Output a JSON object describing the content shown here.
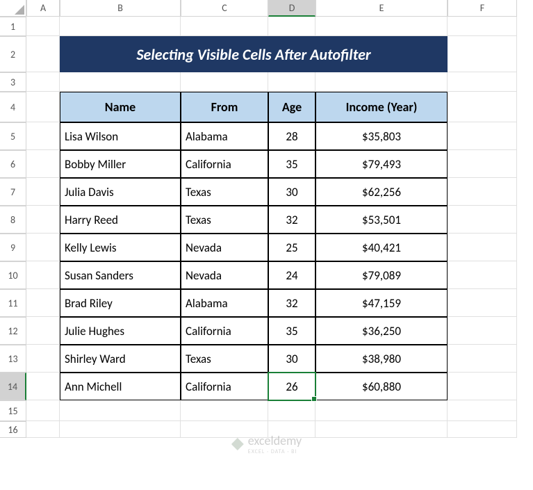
{
  "columns": [
    "A",
    "B",
    "C",
    "D",
    "E",
    "F"
  ],
  "rows": [
    "1",
    "2",
    "3",
    "4",
    "5",
    "6",
    "7",
    "8",
    "9",
    "10",
    "11",
    "12",
    "13",
    "14",
    "15",
    "16"
  ],
  "selected_column": "D",
  "selected_row": "14",
  "title": "Selecting Visible Cells After Autofilter",
  "headers": {
    "name": "Name",
    "from": "From",
    "age": "Age",
    "income": "Income (Year)"
  },
  "data": [
    {
      "name": "Lisa Wilson",
      "from": "Alabama",
      "age": "28",
      "income": "$35,803"
    },
    {
      "name": "Bobby Miller",
      "from": "California",
      "age": "35",
      "income": "$79,493"
    },
    {
      "name": "Julia Davis",
      "from": "Texas",
      "age": "30",
      "income": "$62,256"
    },
    {
      "name": "Harry Reed",
      "from": "Texas",
      "age": "32",
      "income": "$53,501"
    },
    {
      "name": "Kelly Lewis",
      "from": "Nevada",
      "age": "25",
      "income": "$40,421"
    },
    {
      "name": "Susan Sanders",
      "from": "Nevada",
      "age": "24",
      "income": "$79,089"
    },
    {
      "name": "Brad Riley",
      "from": "Alabama",
      "age": "32",
      "income": "$47,159"
    },
    {
      "name": "Julie Hughes",
      "from": "California",
      "age": "35",
      "income": "$36,250"
    },
    {
      "name": "Shirley Ward",
      "from": "Texas",
      "age": "30",
      "income": "$38,980"
    },
    {
      "name": "Ann Michell",
      "from": "California",
      "age": "26",
      "income": "$60,880"
    }
  ],
  "watermark": {
    "text": "exceldemy",
    "sub": "EXCEL · DATA · BI"
  },
  "chart_data": {
    "type": "table",
    "title": "Selecting Visible Cells After Autofilter",
    "columns": [
      "Name",
      "From",
      "Age",
      "Income (Year)"
    ],
    "rows": [
      [
        "Lisa Wilson",
        "Alabama",
        28,
        35803
      ],
      [
        "Bobby Miller",
        "California",
        35,
        79493
      ],
      [
        "Julia Davis",
        "Texas",
        30,
        62256
      ],
      [
        "Harry Reed",
        "Texas",
        32,
        53501
      ],
      [
        "Kelly Lewis",
        "Nevada",
        25,
        40421
      ],
      [
        "Susan Sanders",
        "Nevada",
        24,
        79089
      ],
      [
        "Brad Riley",
        "Alabama",
        32,
        47159
      ],
      [
        "Julie Hughes",
        "California",
        35,
        36250
      ],
      [
        "Shirley Ward",
        "Texas",
        30,
        38980
      ],
      [
        "Ann Michell",
        "California",
        26,
        60880
      ]
    ]
  }
}
